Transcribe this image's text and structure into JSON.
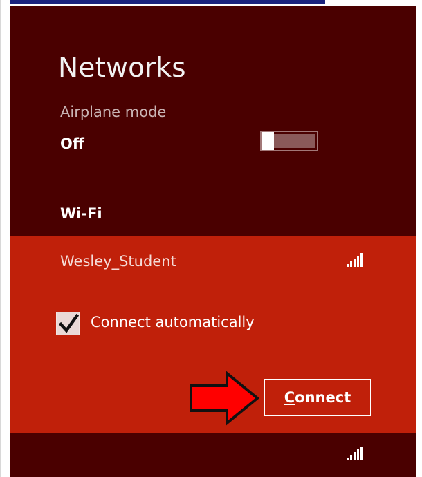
{
  "title": "Networks",
  "airplane": {
    "label": "Airplane mode",
    "state": "Off"
  },
  "wifi": {
    "section_label": "Wi-Fi",
    "selected_network": {
      "ssid": "Wesley_Student",
      "connect_auto_label": "Connect automatically",
      "connect_auto_checked": true,
      "connect_button": {
        "underlined": "C",
        "rest": "onnect"
      },
      "signal_icon": "wifi-signal-icon"
    },
    "next_network": {
      "signal_icon": "wifi-signal-icon"
    }
  },
  "colors": {
    "panel": "#4a0000",
    "selected": "#c0200a",
    "arrow": "#ff0000"
  }
}
